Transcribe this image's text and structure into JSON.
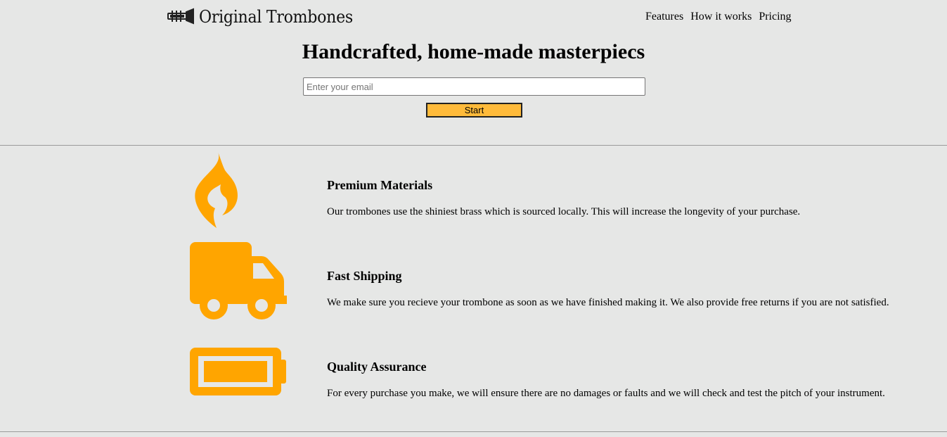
{
  "header": {
    "brand": "Original Trombones",
    "nav": [
      {
        "label": "Features"
      },
      {
        "label": "How it works"
      },
      {
        "label": "Pricing"
      }
    ]
  },
  "hero": {
    "title": "Handcrafted, home-made masterpiecs",
    "email_placeholder": "Enter your email",
    "start_label": "Start"
  },
  "features": [
    {
      "icon": "flame-icon",
      "title": "Premium Materials",
      "text": "Our trombones use the shiniest brass which is sourced locally. This will increase the longevity of your purchase."
    },
    {
      "icon": "truck-icon",
      "title": "Fast Shipping",
      "text": "We make sure you recieve your trombone as soon as we have finished making it. We also provide free returns if you are not satisfied."
    },
    {
      "icon": "battery-icon",
      "title": "Quality Assurance",
      "text": "For every purchase you make, we will ensure there are no damages or faults and we will check and test the pitch of your instrument."
    }
  ],
  "colors": {
    "background": "#e6e7e6",
    "accent": "#ffa500",
    "button": "#ffbb3b"
  }
}
